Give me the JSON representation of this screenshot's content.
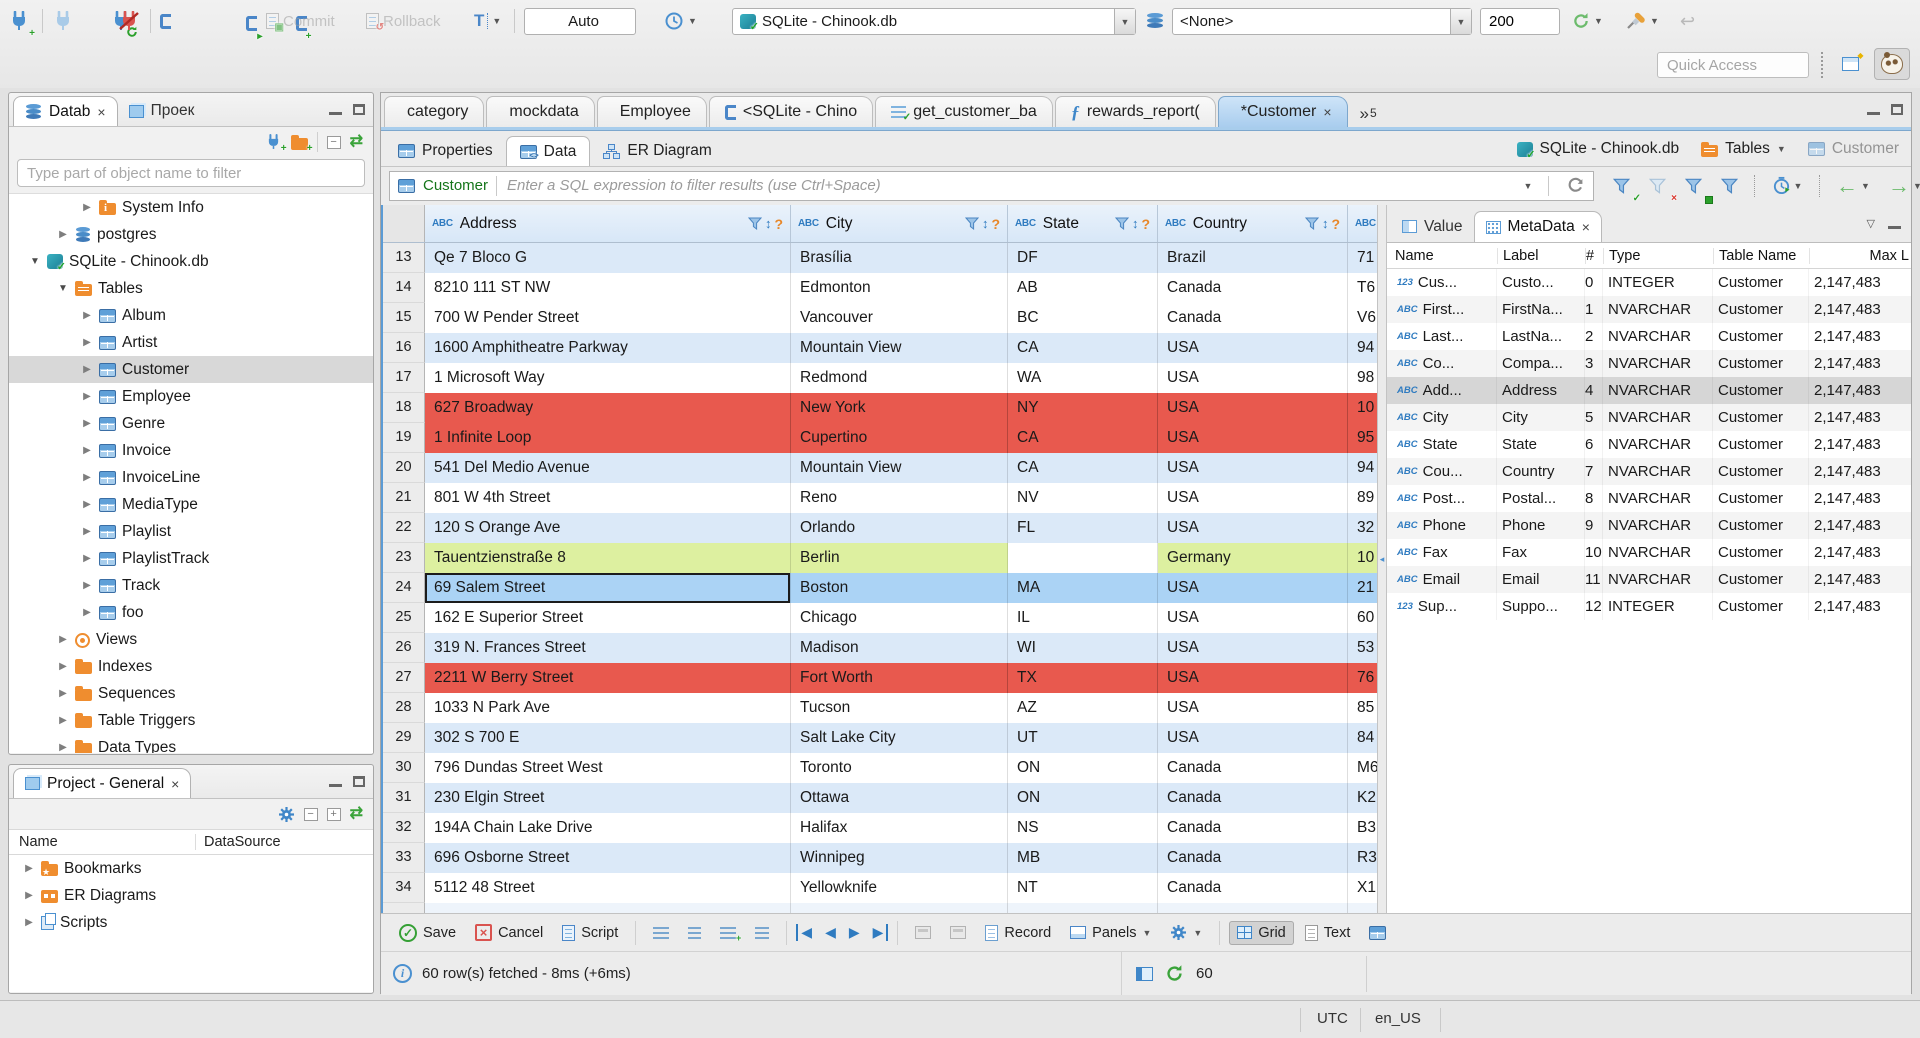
{
  "colors": {
    "accent_blue": "#3e78b5",
    "row_alt": "#dbe9f8",
    "row_red": "#e8594e",
    "row_green": "#ddf0a0",
    "row_selected": "#abd3f5",
    "grid_header": "#dfeaf8",
    "folder_orange": "#ef8d2f",
    "success_green": "#35a035",
    "filter_table_green": "#15751a"
  },
  "toolbar": {
    "commit_label": "Commit",
    "rollback_label": "Rollback",
    "auto_label": "Auto",
    "connection": "SQLite - Chinook.db",
    "schema": "<None>",
    "fetch_size": "200",
    "quick_access_placeholder": "Quick Access"
  },
  "navigator": {
    "tab_database": "Datab",
    "tab_projects": "Проек",
    "filter_placeholder": "Type part of object name to filter",
    "tree": [
      {
        "indent": 2,
        "exp": "c",
        "icon": "folder-info",
        "label": "System Info"
      },
      {
        "indent": 1,
        "exp": "c",
        "icon": "database",
        "label": "postgres"
      },
      {
        "indent": 0,
        "exp": "e",
        "icon": "sqlite",
        "label": "SQLite - Chinook.db"
      },
      {
        "indent": 1,
        "exp": "e",
        "icon": "folder-table",
        "label": "Tables"
      },
      {
        "indent": 2,
        "exp": "c",
        "icon": "table",
        "label": "Album"
      },
      {
        "indent": 2,
        "exp": "c",
        "icon": "table",
        "label": "Artist"
      },
      {
        "indent": 2,
        "exp": "c",
        "icon": "table",
        "label": "Customer",
        "sel": "1"
      },
      {
        "indent": 2,
        "exp": "c",
        "icon": "table",
        "label": "Employee"
      },
      {
        "indent": 2,
        "exp": "c",
        "icon": "table",
        "label": "Genre"
      },
      {
        "indent": 2,
        "exp": "c",
        "icon": "table",
        "label": "Invoice"
      },
      {
        "indent": 2,
        "exp": "c",
        "icon": "table",
        "label": "InvoiceLine"
      },
      {
        "indent": 2,
        "exp": "c",
        "icon": "table",
        "label": "MediaType"
      },
      {
        "indent": 2,
        "exp": "c",
        "icon": "table",
        "label": "Playlist"
      },
      {
        "indent": 2,
        "exp": "c",
        "icon": "table",
        "label": "PlaylistTrack"
      },
      {
        "indent": 2,
        "exp": "c",
        "icon": "table",
        "label": "Track"
      },
      {
        "indent": 2,
        "exp": "c",
        "icon": "table",
        "label": "foo"
      },
      {
        "indent": 1,
        "exp": "c",
        "icon": "views",
        "label": "Views"
      },
      {
        "indent": 1,
        "exp": "c",
        "icon": "folder",
        "label": "Indexes"
      },
      {
        "indent": 1,
        "exp": "c",
        "icon": "folder",
        "label": "Sequences"
      },
      {
        "indent": 1,
        "exp": "c",
        "icon": "folder",
        "label": "Table Triggers"
      },
      {
        "indent": 1,
        "exp": "c",
        "icon": "folder",
        "label": "Data Types"
      }
    ]
  },
  "project_panel": {
    "title": "Project - General",
    "columns": [
      "Name",
      "DataSource"
    ],
    "items": [
      {
        "icon": "folder-star",
        "label": "Bookmarks"
      },
      {
        "icon": "er",
        "label": "ER Diagrams"
      },
      {
        "icon": "scripts",
        "label": "Scripts"
      }
    ]
  },
  "editor_tabs": [
    {
      "icon": "table",
      "label": "category"
    },
    {
      "icon": "table",
      "label": "mockdata"
    },
    {
      "icon": "table",
      "label": "Employee"
    },
    {
      "icon": "sql",
      "label": "<SQLite - Chino"
    },
    {
      "icon": "script",
      "label": "get_customer_ba"
    },
    {
      "icon": "fn",
      "label": "rewards_report("
    },
    {
      "icon": "table",
      "label": "*Customer",
      "state": "active"
    }
  ],
  "editor_tabs_overflow": "5",
  "result_tabs": {
    "properties": "Properties",
    "data": "Data",
    "er": "ER Diagram"
  },
  "breadcrumb": {
    "connection": "SQLite - Chinook.db",
    "container": "Tables",
    "entity": "Customer"
  },
  "filter_bar": {
    "table": "Customer",
    "placeholder": "Enter a SQL expression to filter results (use Ctrl+Space)"
  },
  "grid": {
    "columns": [
      {
        "key": "address",
        "badge": "ABC",
        "name": "Address"
      },
      {
        "key": "city",
        "badge": "ABC",
        "name": "City"
      },
      {
        "key": "state",
        "badge": "ABC",
        "name": "State"
      },
      {
        "key": "country",
        "badge": "ABC",
        "name": "Country"
      },
      {
        "key": "extra",
        "badge": "ABC",
        "name": ""
      }
    ],
    "rows": [
      {
        "num": "13",
        "address": "Qe 7 Bloco G",
        "city": "Brasília",
        "state": "DF",
        "country": "Brazil",
        "extra": "71",
        "variant": "alt"
      },
      {
        "num": "14",
        "address": "8210 111 ST NW",
        "city": "Edmonton",
        "state": "AB",
        "country": "Canada",
        "extra": "T6",
        "variant": "plain"
      },
      {
        "num": "15",
        "address": "700 W Pender Street",
        "city": "Vancouver",
        "state": "BC",
        "country": "Canada",
        "extra": "V6",
        "variant": "plain"
      },
      {
        "num": "16",
        "address": "1600 Amphitheatre Parkway",
        "city": "Mountain View",
        "state": "CA",
        "country": "USA",
        "extra": "94",
        "variant": "alt"
      },
      {
        "num": "17",
        "address": "1 Microsoft Way",
        "city": "Redmond",
        "state": "WA",
        "country": "USA",
        "extra": "98",
        "variant": "plain"
      },
      {
        "num": "18",
        "address": "627 Broadway",
        "city": "New York",
        "state": "NY",
        "country": "USA",
        "extra": "10",
        "variant": "red"
      },
      {
        "num": "19",
        "address": "1 Infinite Loop",
        "city": "Cupertino",
        "state": "CA",
        "country": "USA",
        "extra": "95",
        "variant": "red"
      },
      {
        "num": "20",
        "address": "541 Del Medio Avenue",
        "city": "Mountain View",
        "state": "CA",
        "country": "USA",
        "extra": "94",
        "variant": "alt"
      },
      {
        "num": "21",
        "address": "801 W 4th Street",
        "city": "Reno",
        "state": "NV",
        "country": "USA",
        "extra": "89",
        "variant": "plain"
      },
      {
        "num": "22",
        "address": "120 S Orange Ave",
        "city": "Orlando",
        "state": "FL",
        "country": "USA",
        "extra": "32",
        "variant": "alt"
      },
      {
        "num": "23",
        "address": "Tauentzienstraße 8",
        "city": "Berlin",
        "state": "",
        "country": "Germany",
        "extra": "10",
        "variant": "green"
      },
      {
        "num": "24",
        "address": "69 Salem Street",
        "city": "Boston",
        "state": "MA",
        "country": "USA",
        "extra": "21",
        "variant": "selected"
      },
      {
        "num": "25",
        "address": "162 E Superior Street",
        "city": "Chicago",
        "state": "IL",
        "country": "USA",
        "extra": "60",
        "variant": "plain"
      },
      {
        "num": "26",
        "address": "319 N. Frances Street",
        "city": "Madison",
        "state": "WI",
        "country": "USA",
        "extra": "53",
        "variant": "alt"
      },
      {
        "num": "27",
        "address": "2211 W Berry Street",
        "city": "Fort Worth",
        "state": "TX",
        "country": "USA",
        "extra": "76",
        "variant": "red"
      },
      {
        "num": "28",
        "address": "1033 N Park Ave",
        "city": "Tucson",
        "state": "AZ",
        "country": "USA",
        "extra": "85",
        "variant": "plain"
      },
      {
        "num": "29",
        "address": "302 S 700 E",
        "city": "Salt Lake City",
        "state": "UT",
        "country": "USA",
        "extra": "84",
        "variant": "alt"
      },
      {
        "num": "30",
        "address": "796 Dundas Street West",
        "city": "Toronto",
        "state": "ON",
        "country": "Canada",
        "extra": "M6",
        "variant": "plain"
      },
      {
        "num": "31",
        "address": "230 Elgin Street",
        "city": "Ottawa",
        "state": "ON",
        "country": "Canada",
        "extra": "K2",
        "variant": "alt"
      },
      {
        "num": "32",
        "address": "194A Chain Lake Drive",
        "city": "Halifax",
        "state": "NS",
        "country": "Canada",
        "extra": "B3",
        "variant": "plain"
      },
      {
        "num": "33",
        "address": "696 Osborne Street",
        "city": "Winnipeg",
        "state": "MB",
        "country": "Canada",
        "extra": "R3",
        "variant": "alt"
      },
      {
        "num": "34",
        "address": "5112 48 Street",
        "city": "Yellowknife",
        "state": "NT",
        "country": "Canada",
        "extra": "X1",
        "variant": "plain"
      }
    ]
  },
  "metadata_panel": {
    "tab_value": "Value",
    "tab_metadata": "MetaData",
    "columns": [
      "Name",
      "Label",
      "#",
      "Type",
      "Table Name",
      "Max L"
    ],
    "rows": [
      {
        "kind": "123",
        "name": "Cus...",
        "label": "Custo...",
        "num": "0",
        "type": "INTEGER",
        "table": "Customer",
        "max": "2,147,483"
      },
      {
        "kind": "ABC",
        "name": "First...",
        "label": "FirstNa...",
        "num": "1",
        "type": "NVARCHAR",
        "table": "Customer",
        "max": "2,147,483"
      },
      {
        "kind": "ABC",
        "name": "Last...",
        "label": "LastNa...",
        "num": "2",
        "type": "NVARCHAR",
        "table": "Customer",
        "max": "2,147,483"
      },
      {
        "kind": "ABC",
        "name": "Co...",
        "label": "Compa...",
        "num": "3",
        "type": "NVARCHAR",
        "table": "Customer",
        "max": "2,147,483"
      },
      {
        "kind": "ABC",
        "name": "Add...",
        "label": "Address",
        "num": "4",
        "type": "NVARCHAR",
        "table": "Customer",
        "max": "2,147,483",
        "sel": "1"
      },
      {
        "kind": "ABC",
        "name": "City",
        "label": "City",
        "num": "5",
        "type": "NVARCHAR",
        "table": "Customer",
        "max": "2,147,483"
      },
      {
        "kind": "ABC",
        "name": "State",
        "label": "State",
        "num": "6",
        "type": "NVARCHAR",
        "table": "Customer",
        "max": "2,147,483"
      },
      {
        "kind": "ABC",
        "name": "Cou...",
        "label": "Country",
        "num": "7",
        "type": "NVARCHAR",
        "table": "Customer",
        "max": "2,147,483"
      },
      {
        "kind": "ABC",
        "name": "Post...",
        "label": "Postal...",
        "num": "8",
        "type": "NVARCHAR",
        "table": "Customer",
        "max": "2,147,483"
      },
      {
        "kind": "ABC",
        "name": "Phone",
        "label": "Phone",
        "num": "9",
        "type": "NVARCHAR",
        "table": "Customer",
        "max": "2,147,483"
      },
      {
        "kind": "ABC",
        "name": "Fax",
        "label": "Fax",
        "num": "10",
        "type": "NVARCHAR",
        "table": "Customer",
        "max": "2,147,483"
      },
      {
        "kind": "ABC",
        "name": "Email",
        "label": "Email",
        "num": "11",
        "type": "NVARCHAR",
        "table": "Customer",
        "max": "2,147,483"
      },
      {
        "kind": "123",
        "name": "Sup...",
        "label": "Suppo...",
        "num": "12",
        "type": "INTEGER",
        "table": "Customer",
        "max": "2,147,483"
      }
    ]
  },
  "bottom_toolbar": {
    "save": "Save",
    "cancel": "Cancel",
    "script": "Script",
    "record": "Record",
    "panels": "Panels",
    "grid": "Grid",
    "text": "Text"
  },
  "status": {
    "message": "60 row(s) fetched - 8ms (+6ms)",
    "refresh_value": "60"
  },
  "statusbar": {
    "timezone": "UTC",
    "locale": "en_US"
  }
}
